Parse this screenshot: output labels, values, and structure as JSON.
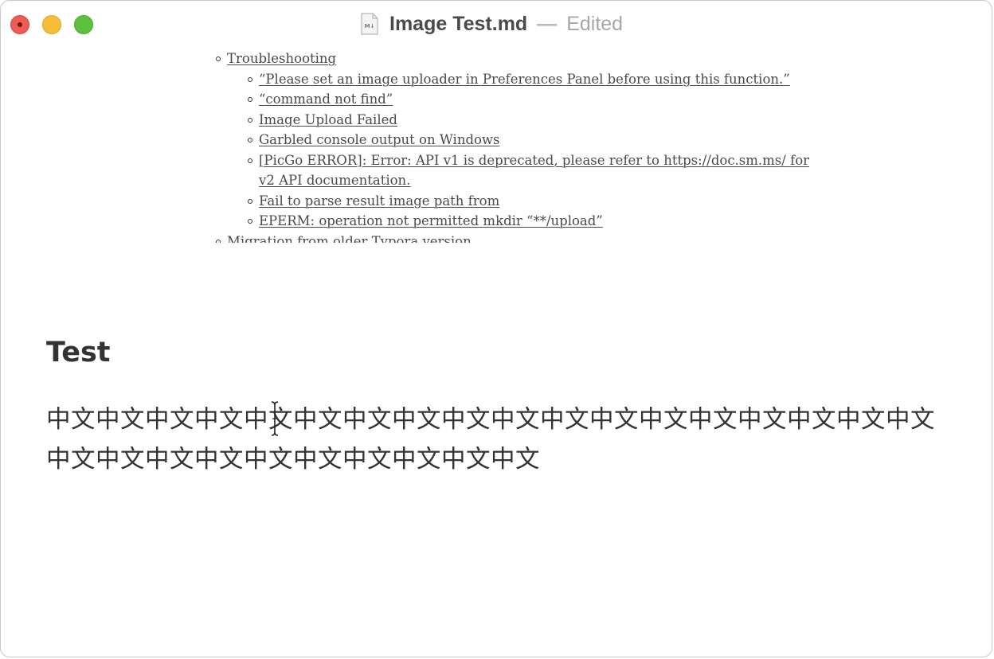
{
  "window": {
    "title": "Image Test.md",
    "separator": "—",
    "status": "Edited",
    "file_icon": "markdown-file-icon",
    "file_icon_label": "M↓"
  },
  "toc": {
    "troubleshooting": "Troubleshooting",
    "sub_items": [
      "“Please set an image uploader in Preferences Panel before using this function.”",
      "“command not find”",
      "Image Upload Failed",
      "Garbled console output on Windows",
      "[PicGo ERROR]: Error: API v1 is deprecated, please refer to https://doc.sm.ms/ for v2 API documentation.",
      "Fail to parse result image path from",
      "EPERM: operation not permitted mkdir “**/upload”"
    ],
    "migration": "Migration from older Typora version"
  },
  "content": {
    "heading": "Test",
    "paragraph": "中文中文中文中文中文中文中文中文中文中文中文中文中文中文中文中文中文中文中文中文中文中文中文中文中文中文中文中文"
  },
  "colors": {
    "close": "#ee5d55",
    "minimize": "#f6bd38",
    "maximize": "#5ec13d",
    "text": "#333333"
  }
}
